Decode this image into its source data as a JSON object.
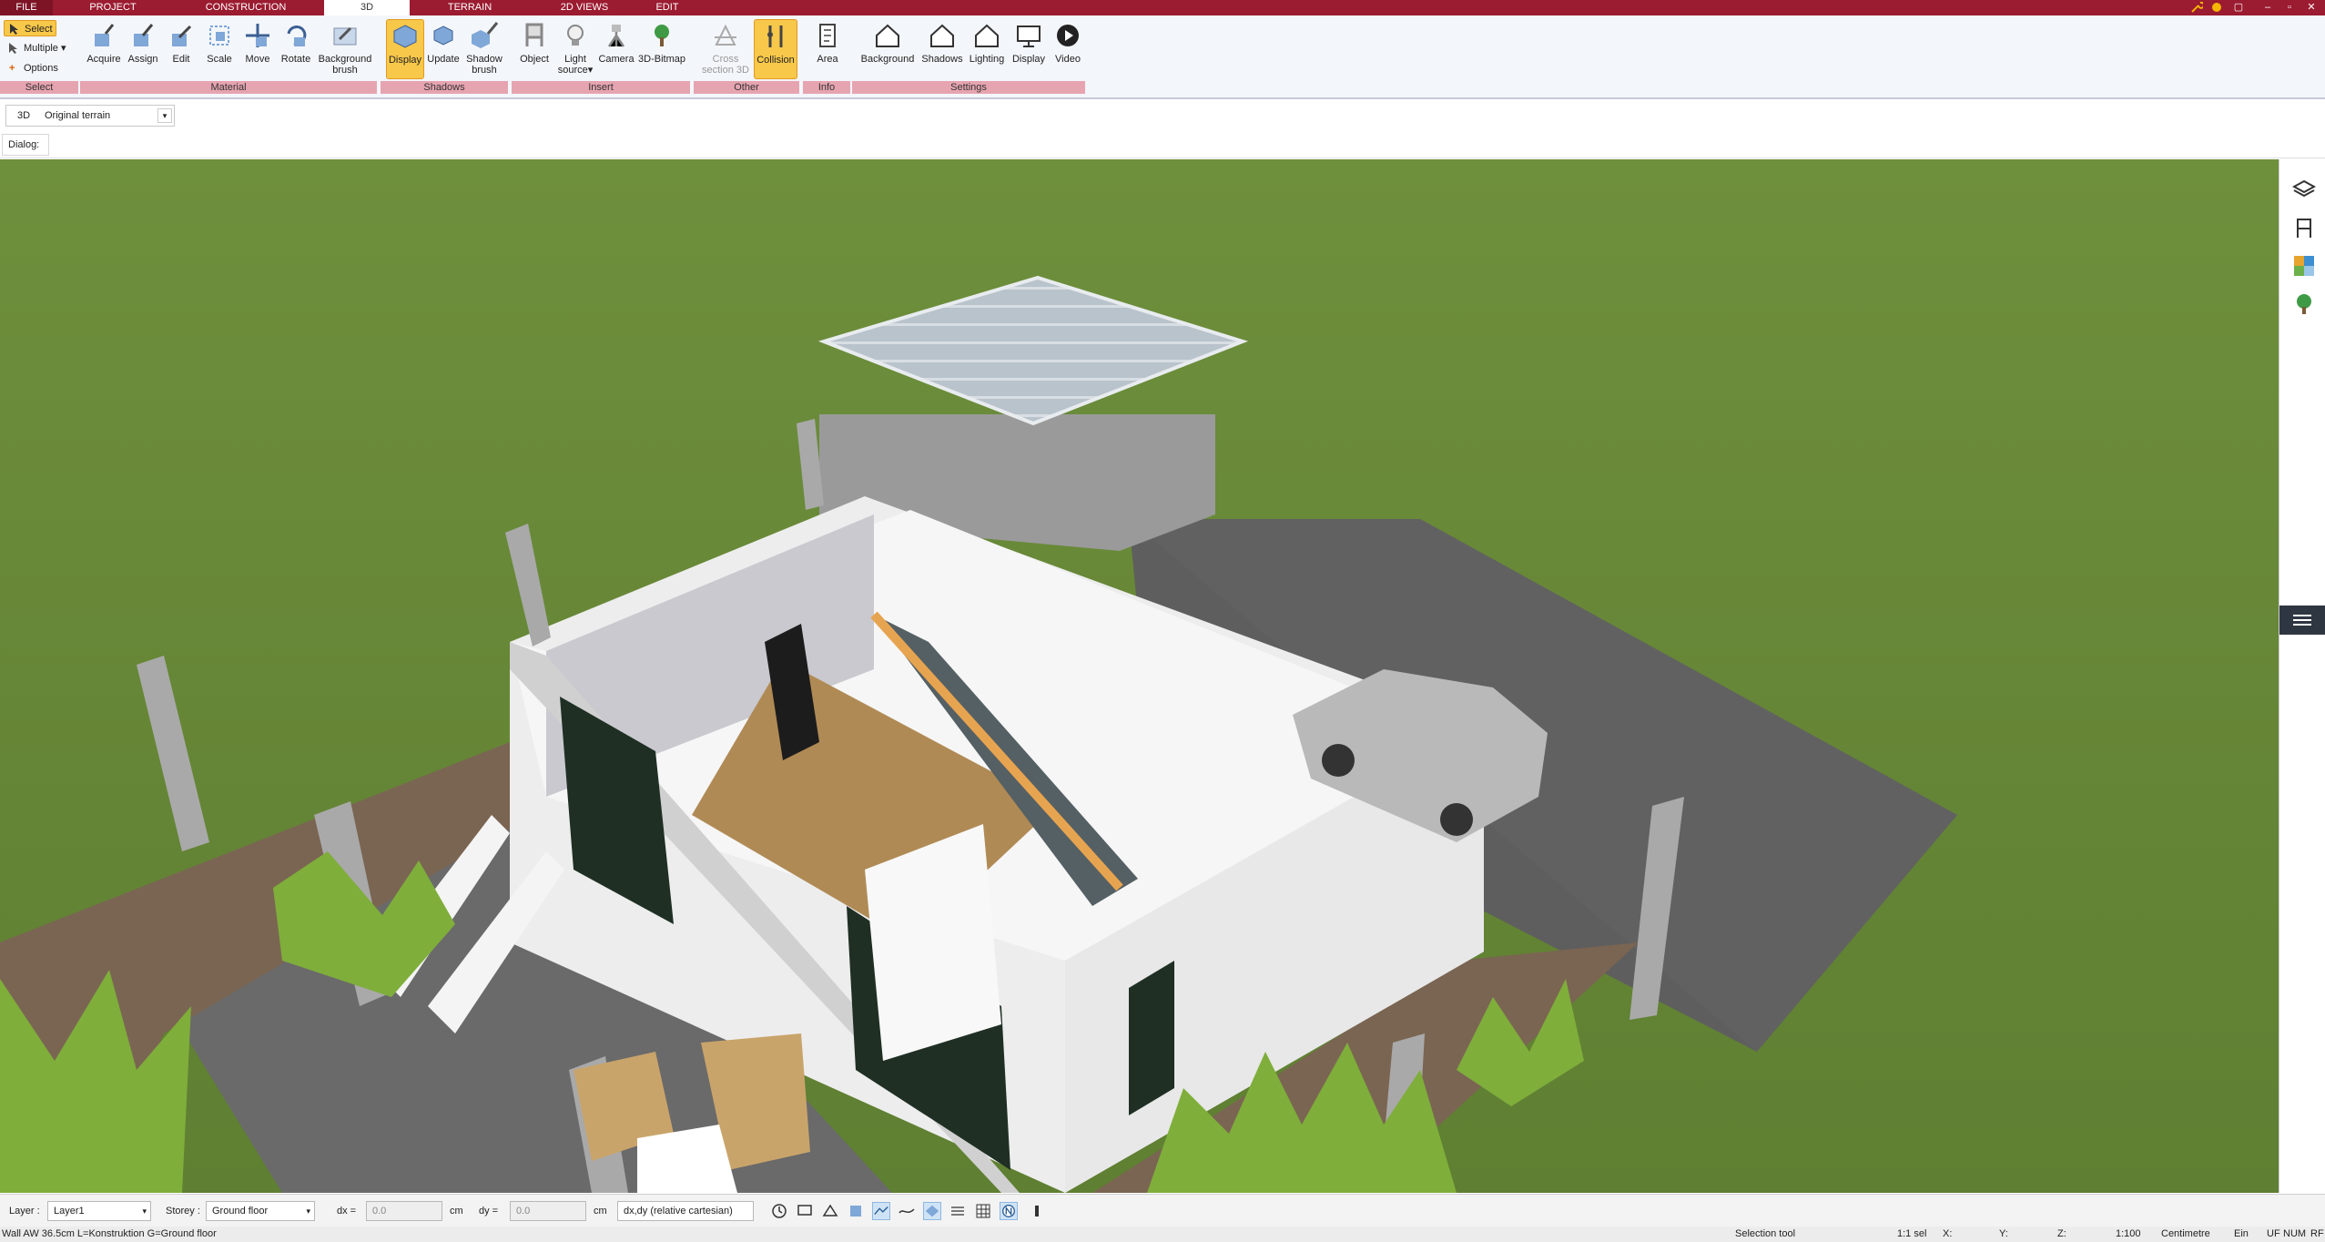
{
  "tabs": {
    "file": "FILE",
    "project": "PROJECT",
    "construction": "CONSTRUCTION",
    "threed": "3D",
    "terrain": "TERRAIN",
    "views2d": "2D VIEWS",
    "edit": "EDIT"
  },
  "ribbon": {
    "select": {
      "select": "Select",
      "multiple": "Multiple",
      "options": "Options",
      "group": "Select"
    },
    "material": {
      "acquire": "Acquire",
      "assign": "Assign",
      "edit": "Edit",
      "scale": "Scale",
      "move": "Move",
      "rotate": "Rotate",
      "background_brush_1": "Background",
      "background_brush_2": "brush",
      "group": "Material"
    },
    "shadows": {
      "display": "Display",
      "update": "Update",
      "shadow_brush_1": "Shadow",
      "shadow_brush_2": "brush",
      "group": "Shadows"
    },
    "insert": {
      "object": "Object",
      "light_source_1": "Light",
      "light_source_2": "source",
      "camera": "Camera",
      "bitmap": "3D-Bitmap",
      "group": "Insert"
    },
    "other": {
      "cross_section_1": "Cross",
      "cross_section_2": "section 3D",
      "collision": "Collision",
      "group": "Other"
    },
    "info": {
      "area": "Area",
      "group": "Info"
    },
    "settings": {
      "background": "Background",
      "shadows": "Shadows",
      "lighting": "Lighting",
      "display": "Display",
      "video": "Video",
      "group": "Settings"
    }
  },
  "view": {
    "mode": "3D",
    "terrain": "Original terrain",
    "dialog_label": "Dialog:"
  },
  "bottombar": {
    "layer_label": "Layer :",
    "layer_value": "Layer1",
    "storey_label": "Storey :",
    "storey_value": "Ground floor",
    "dx_label": "dx =",
    "dx_value": "0.0",
    "dx_unit": "cm",
    "dy_label": "dy =",
    "dy_value": "0.0",
    "dy_unit": "cm",
    "coord_mode": "dx,dy (relative cartesian)"
  },
  "status": {
    "info": "Wall AW 36.5cm L=Konstruktion G=Ground floor",
    "tool": "Selection tool",
    "selection": "1:1 sel",
    "x": "X:",
    "y": "Y:",
    "z": "Z:",
    "scale": "1:100",
    "unit": "Centimetre",
    "ein": "Ein",
    "uf": "UF",
    "num": "NUM",
    "rf": "RF"
  },
  "colors": {
    "accent": "#9b1b30",
    "group_bar": "#e6a4b0",
    "active_button": "#f8c84a",
    "grass": "#6b8c3e"
  }
}
